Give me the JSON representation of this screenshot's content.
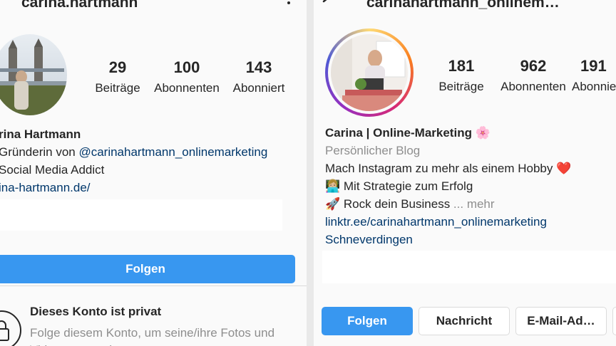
{
  "left": {
    "username": "carina.hartmann",
    "stats": [
      {
        "value": "29",
        "label": "Beiträge"
      },
      {
        "value": "100",
        "label": "Abonnenten"
      },
      {
        "value": "143",
        "label": "Abonniert"
      }
    ],
    "bio": {
      "name": "rina Hartmann",
      "line1_prefix": "Gründerin von ",
      "line1_mention": "@carinahartmann_onlinemarketing",
      "line2": "Social Media Addict",
      "website": "ina-hartmann.de/"
    },
    "follow_label": "Folgen",
    "private": {
      "title": "Dieses Konto ist privat",
      "text": "Folge diesem Konto, um seine/ihre Fotos und Videos anzusehen."
    }
  },
  "right": {
    "username": "carinahartmann_onlinem…",
    "stats": [
      {
        "value": "181",
        "label": "Beiträge"
      },
      {
        "value": "962",
        "label": "Abonnenten"
      },
      {
        "value": "191",
        "label": "Abonniert"
      }
    ],
    "bio": {
      "name": "Carina | Online-Marketing 🌸",
      "category": "Persönlicher Blog",
      "line1": "Mach Instagram zu mehr als einem Hobby ❤️",
      "line2": "👩🏼‍💻 Mit Strategie zum Erfolg",
      "line3": "🚀 Rock dein Business",
      "more": " ... mehr",
      "link": "linktr.ee/carinahartmann_onlinemarketing",
      "location": "Schneverdingen"
    },
    "buttons": {
      "follow": "Folgen",
      "message": "Nachricht",
      "email": "E-Mail-Ad…"
    }
  }
}
